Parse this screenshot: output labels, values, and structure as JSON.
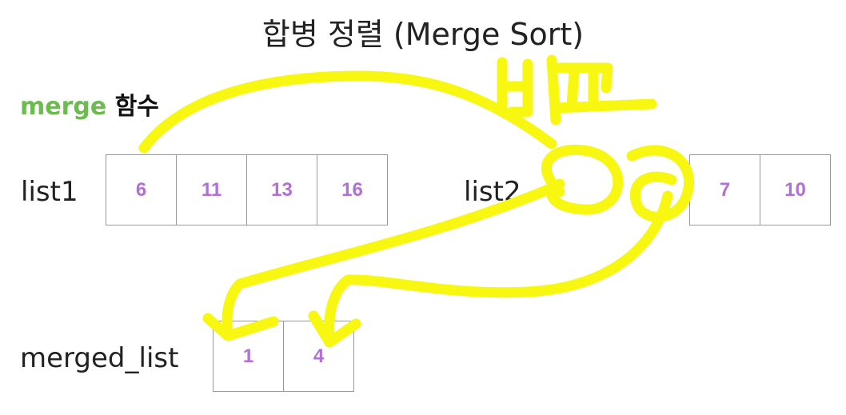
{
  "title": "합병 정렬 (Merge Sort)",
  "function_label": {
    "keyword": "merge",
    "suffix": "함수"
  },
  "list1": {
    "label": "list1",
    "values": [
      "6",
      "11",
      "13",
      "16"
    ]
  },
  "list2": {
    "label": "list2",
    "values": [
      "7",
      "10"
    ]
  },
  "merged_list": {
    "label": "merged_list",
    "values": [
      "1",
      "4",
      ""
    ]
  },
  "annotation": {
    "handwritten_text": "비교",
    "color": "#f7f711"
  },
  "colors": {
    "keyword": "#6abd4c",
    "cell_value": "#b070d6",
    "cell_border": "#999999"
  }
}
